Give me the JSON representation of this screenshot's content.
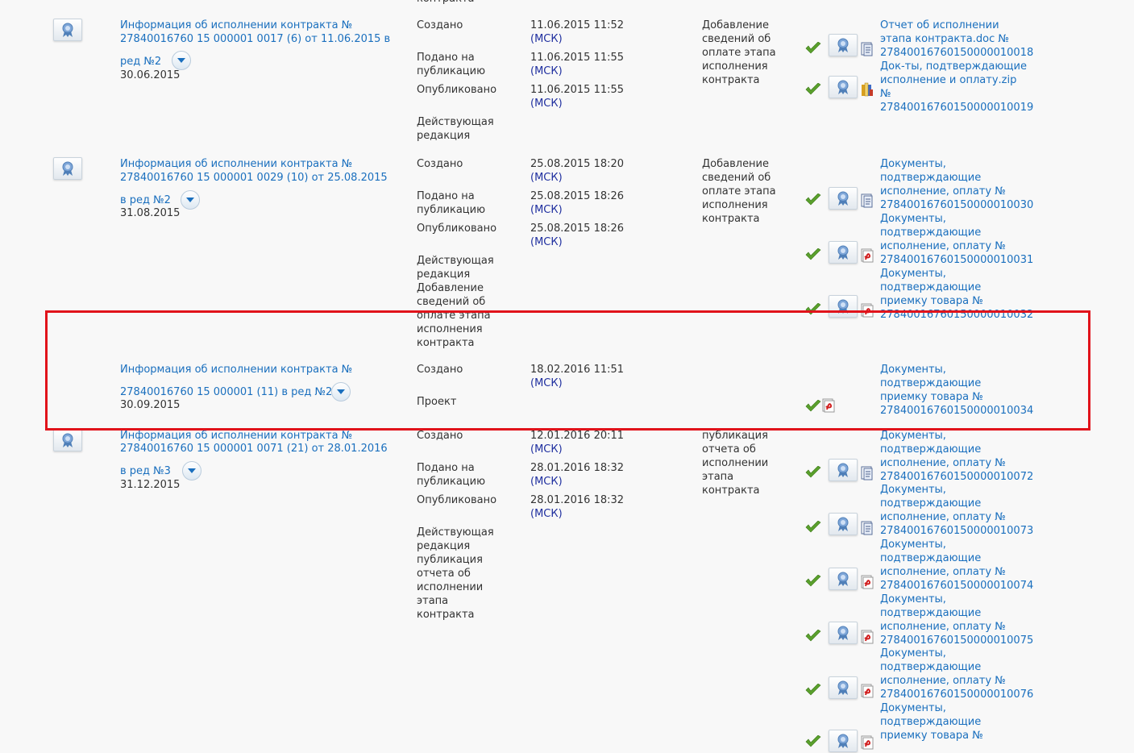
{
  "rows": [
    {
      "title": "Информация об исполнении контракта № 27840016760 15 000001 0017 (6) от 11.06.2015 в",
      "title_l1": "Информация об исполнении контракта №",
      "title_l2": "27840016760 15 000001 0017 (6) от 11.06.2015 в",
      "red": "ред №2",
      "date": "30.06.2015",
      "statuses": [
        {
          "label": "Создано",
          "time": "11.06.2015 11:52",
          "tz": "(МСК)"
        },
        {
          "label": "Подано на публикацию",
          "time": "11.06.2015 11:55",
          "tz": "(МСК)"
        },
        {
          "label": "Опубликовано",
          "time": "11.06.2015 11:55",
          "tz": "(МСК)"
        },
        {
          "label": "Действующая редакция"
        }
      ],
      "reason": "Добавление сведений об оплате этапа исполнения контракта",
      "docs": [
        {
          "name": "Отчет об исполнении этапа контракта.doc № 27840016760150000010018",
          "icon": "doc-icon"
        },
        {
          "name": "Док-ты, подтверждающие исполнение и оплату.zip № 27840016760150000010019",
          "icon": "archive-icon"
        }
      ]
    },
    {
      "title_l1": "Информация об исполнении контракта №",
      "title_l2": "27840016760 15 000001 0029 (10) от 25.08.2015",
      "red": "в ред №2",
      "date": "31.08.2015",
      "statuses": [
        {
          "label": "Создано",
          "time": "25.08.2015 18:20",
          "tz": "(МСК)"
        },
        {
          "label": "Подано на публикацию",
          "time": "25.08.2015 18:26",
          "tz": "(МСК)"
        },
        {
          "label": "Опубликовано",
          "time": "25.08.2015 18:26",
          "tz": "(МСК)"
        },
        {
          "label": "Действующая редакция Добавление сведений об оплате этапа исполнения контракта"
        }
      ],
      "reason": "Добавление сведений об оплате этапа исполнения контракта",
      "docs": [
        {
          "name": "Документы, подтверждающие исполнение, оплату № 27840016760150000010030",
          "icon": "doc-icon"
        },
        {
          "name": "Документы, подтверждающие исполнение, оплату № 27840016760150000010031",
          "icon": "pdf-icon"
        },
        {
          "name": "Документы, подтверждающие приемку товара № 27840016760150000010032",
          "icon": "pdf-icon"
        }
      ]
    },
    {
      "title_l1": "Информация об исполнении контракта №",
      "title_l2": "27840016760 15 000001 (11) в ред №2",
      "date": "30.09.2015",
      "statuses": [
        {
          "label": "Создано",
          "time": "18.02.2016 11:51",
          "tz": "(МСК)"
        },
        {
          "label": "Проект"
        }
      ],
      "docs": [
        {
          "name": "Документы, подтверждающие приемку товара № 27840016760150000010034",
          "icon": "pdf-icon"
        }
      ]
    },
    {
      "title_l1": "Информация об исполнении контракта №",
      "title_l2": "27840016760 15 000001 0071 (21) от 28.01.2016",
      "red": "в ред №3",
      "date": "31.12.2015",
      "statuses": [
        {
          "label": "Создано",
          "time": "12.01.2016 20:11",
          "tz": "(МСК)"
        },
        {
          "label": "Подано на публикацию",
          "time": "28.01.2016 18:32",
          "tz": "(МСК)"
        },
        {
          "label": "Опубликовано",
          "time": "28.01.2016 18:32",
          "tz": "(МСК)"
        },
        {
          "label": "Действующая редакция публикация отчета об исполнении этапа контракта"
        }
      ],
      "reason": "публикация отчета об исполнении этапа контракта",
      "docs": [
        {
          "name": "Документы, подтверждающие исполнение, оплату № 27840016760150000010072",
          "icon": "doc-icon"
        },
        {
          "name": "Документы, подтверждающие исполнение, оплату № 27840016760150000010073",
          "icon": "doc-icon"
        },
        {
          "name": "Документы, подтверждающие исполнение, оплату № 27840016760150000010074",
          "icon": "pdf-icon"
        },
        {
          "name": "Документы, подтверждающие исполнение, оплату № 27840016760150000010075",
          "icon": "pdf-icon"
        },
        {
          "name": "Документы, подтверждающие исполнение, оплату № 27840016760150000010076",
          "icon": "pdf-icon"
        },
        {
          "name": "Документы, подтверждающие приемку товара №",
          "icon": "pdf-icon"
        }
      ]
    }
  ],
  "top_fragment": "контракта",
  "colors": {
    "link": "#1a6fbe",
    "tz": "#1f2f9f",
    "highlight": "#e1131b",
    "check": "#5aa02c",
    "pdf": "#d11f1f"
  }
}
